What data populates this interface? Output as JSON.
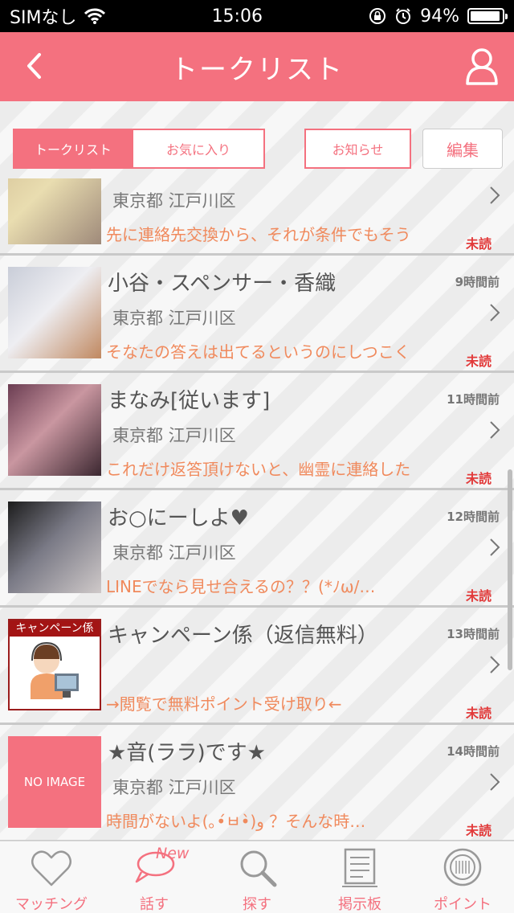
{
  "status_bar": {
    "carrier": "SIMなし",
    "time": "15:06",
    "battery_percent": "94%",
    "battery_level": 0.94
  },
  "header": {
    "title": "トークリスト"
  },
  "tabs": {
    "talk_list": "トークリスト",
    "favorites": "お気に入り",
    "notices": "お知らせ",
    "edit": "編集"
  },
  "threads": [
    {
      "name": "",
      "time": "",
      "location": "東京都 江戸川区",
      "message": "先に連絡先交換から、それが条件でもそう",
      "status": "未読",
      "thumb": "photo"
    },
    {
      "name": "小谷・スペンサー・香織",
      "time": "9時間前",
      "location": "東京都 江戸川区",
      "message": "そなたの答えは出てるというのにしつこく",
      "status": "未読",
      "thumb": "photo"
    },
    {
      "name": "まなみ[従います]",
      "time": "11時間前",
      "location": "東京都 江戸川区",
      "message": "これだけ返答頂けないと、幽霊に連絡した",
      "status": "未読",
      "thumb": "photo"
    },
    {
      "name": "お○にーしよ♥",
      "time": "12時間前",
      "location": "東京都 江戸川区",
      "message": "LINEでなら見せ合えるの？？(*ﾉω/…",
      "status": "未読",
      "thumb": "photo"
    },
    {
      "name": "キャンペーン係（返信無料）",
      "time": "13時間前",
      "location": "",
      "message": "→閲覧で無料ポイント受け取り←",
      "status": "未読",
      "thumb": "campaign",
      "thumb_label": "キャンペーン係"
    },
    {
      "name": "★音(ララ)です★",
      "time": "14時間前",
      "location": "東京都 江戸川区",
      "message": "時間がないよ(｡•́ㅂ•̀)و ？そんな時…",
      "status": "未読",
      "thumb": "noimage",
      "thumb_label": "NO IMAGE"
    }
  ],
  "tabbar": {
    "matching": "マッチング",
    "talk": "話す",
    "talk_badge": "New",
    "search": "探す",
    "board": "掲示板",
    "points": "ポイント"
  },
  "colors": {
    "accent": "#f4717f",
    "message": "#f08a5d",
    "unread": "#e23a3a"
  }
}
